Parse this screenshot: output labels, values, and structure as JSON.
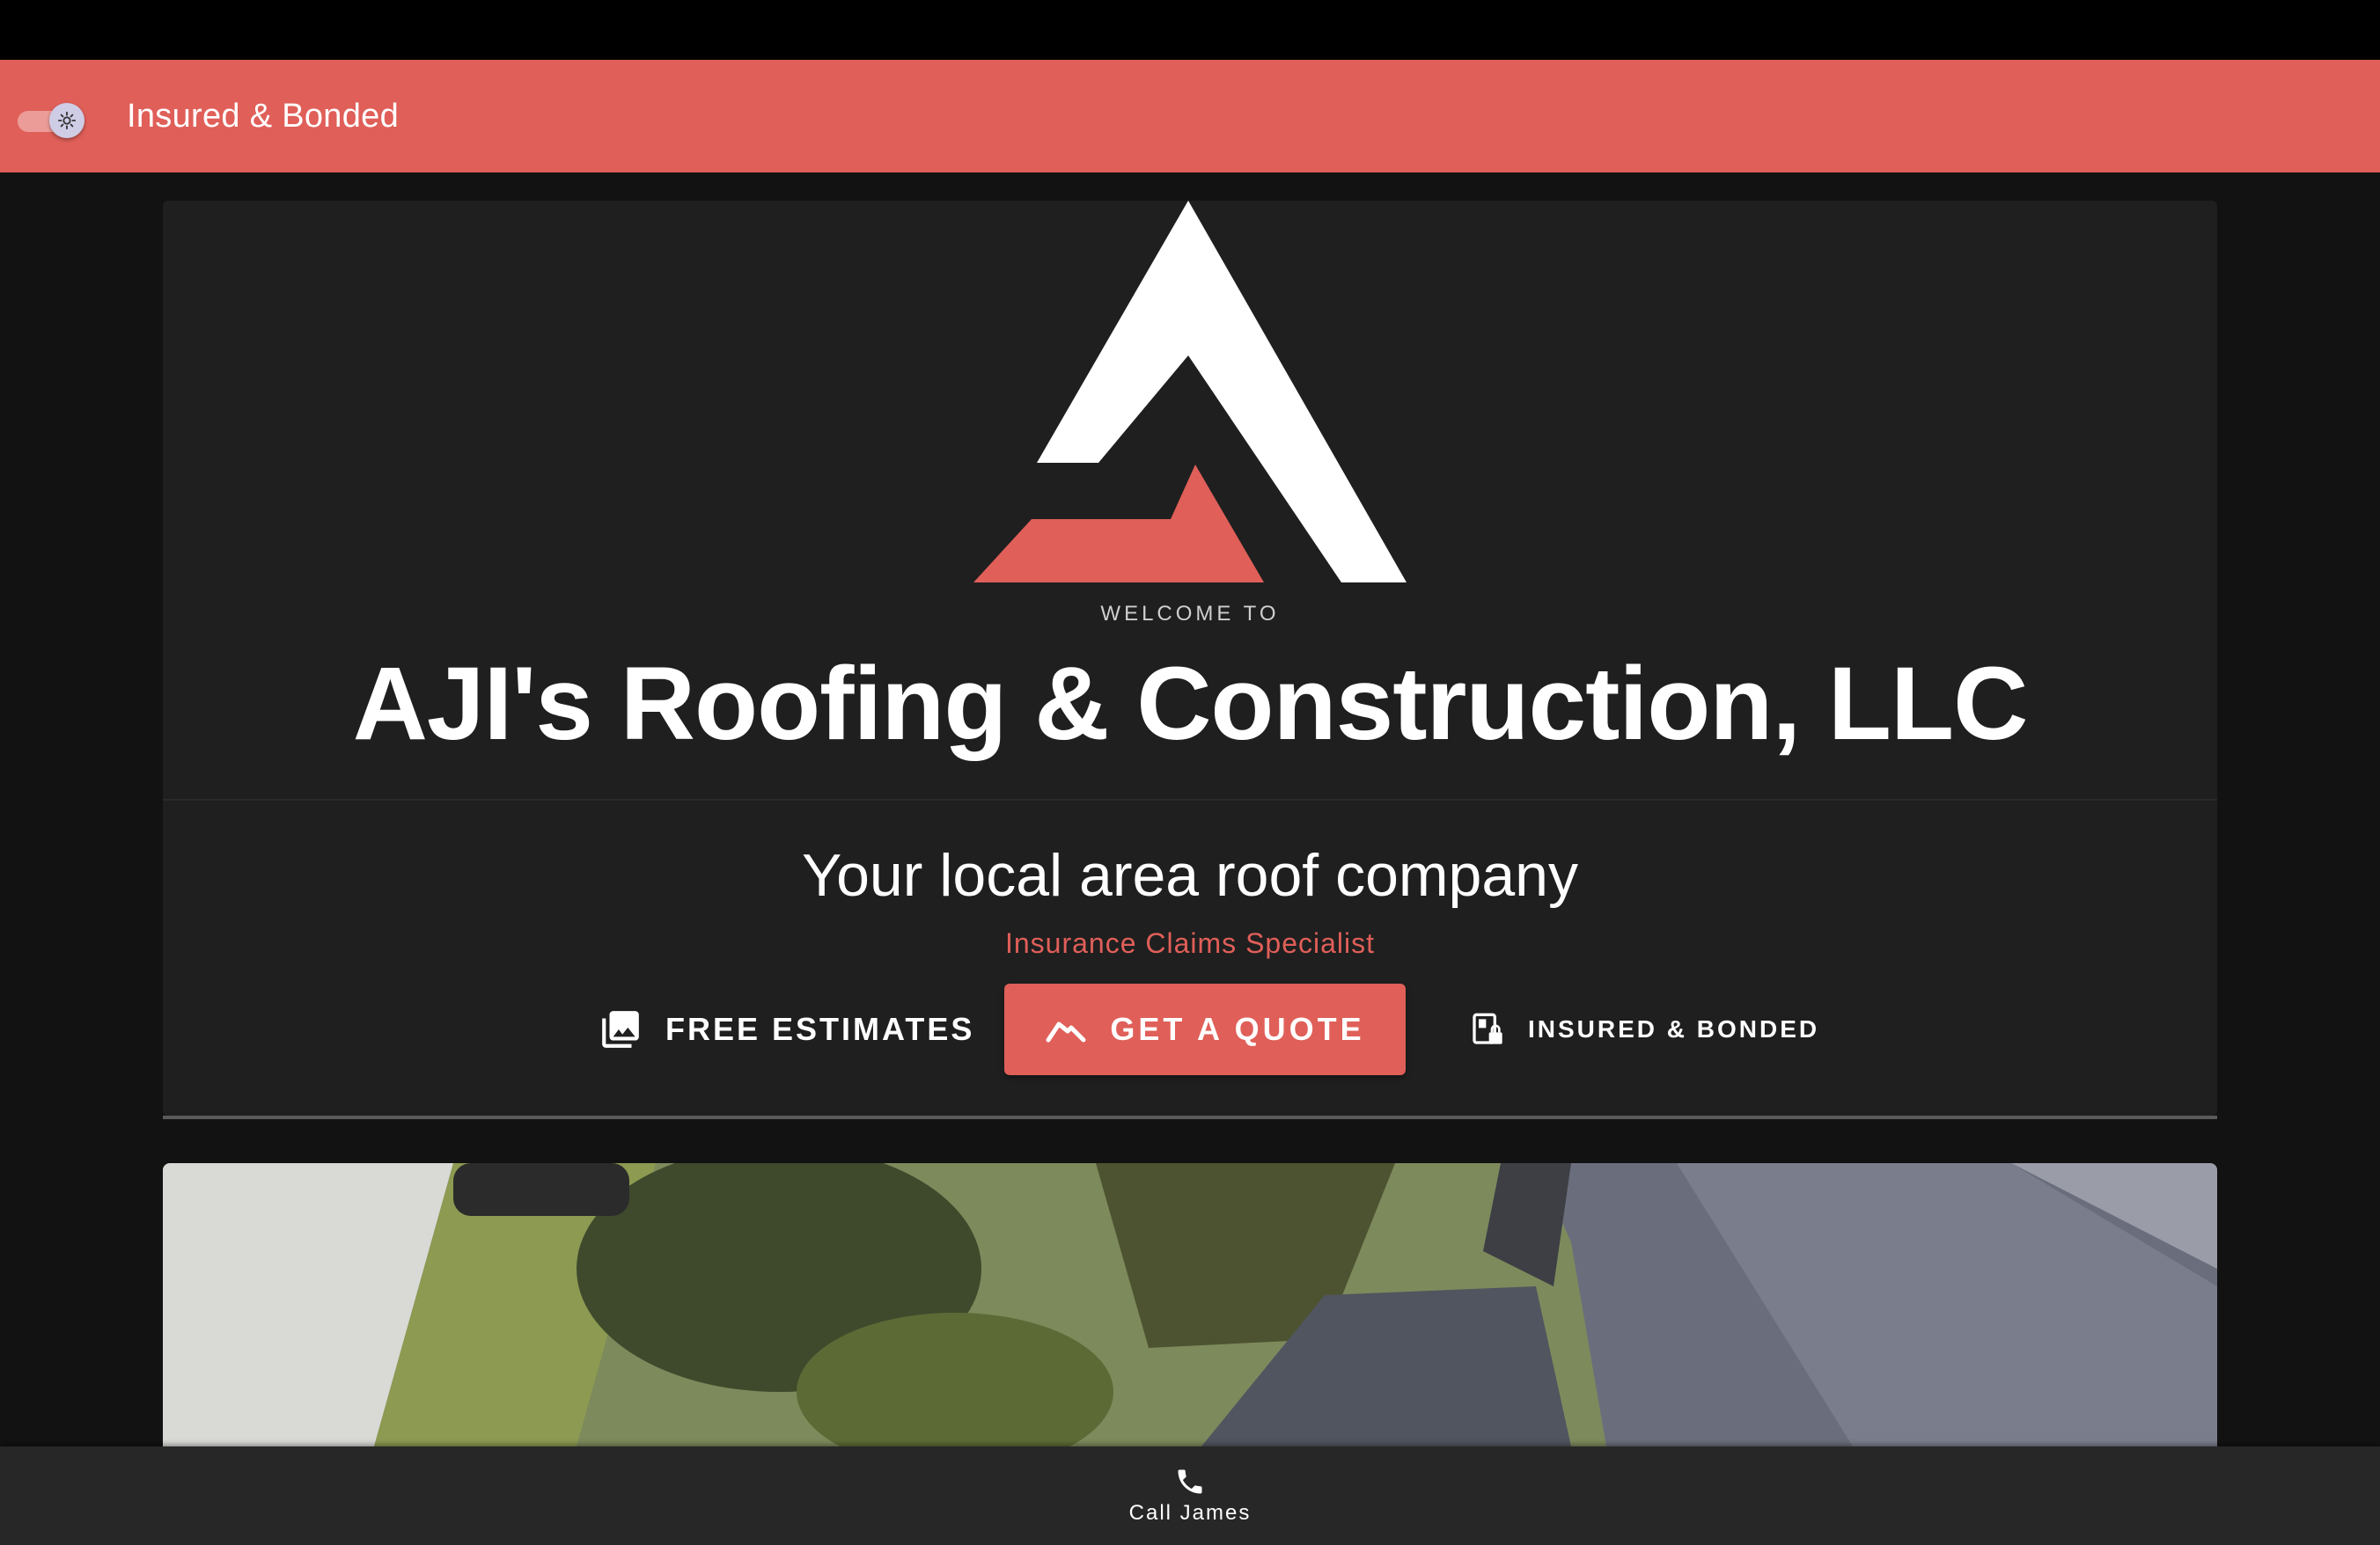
{
  "app_bar": {
    "title": "Insured & Bonded",
    "theme_toggle_icon": "brightness-icon",
    "background_color": "#e05f59"
  },
  "hero": {
    "welcome": "WELCOME TO",
    "company_name": "AJI's Roofing & Construction, LLC",
    "tagline": "Your local area roof company",
    "specialty": "Insurance Claims Specialist",
    "logo_icon": "roof-a-logo"
  },
  "actions": {
    "free_estimates": {
      "label": "FREE ESTIMATES",
      "icon": "photo-library-icon"
    },
    "get_quote": {
      "label": "GET A QUOTE",
      "icon": "roof-chevron-icon"
    },
    "insured": {
      "label": "INSURED & BONDED",
      "icon": "badge-lock-icon"
    }
  },
  "bottom_nav": {
    "call": {
      "label": "Call James",
      "icon": "phone-icon"
    }
  },
  "colors": {
    "accent": "#e05f59",
    "card": "#1f1f1f",
    "background": "#121212"
  }
}
